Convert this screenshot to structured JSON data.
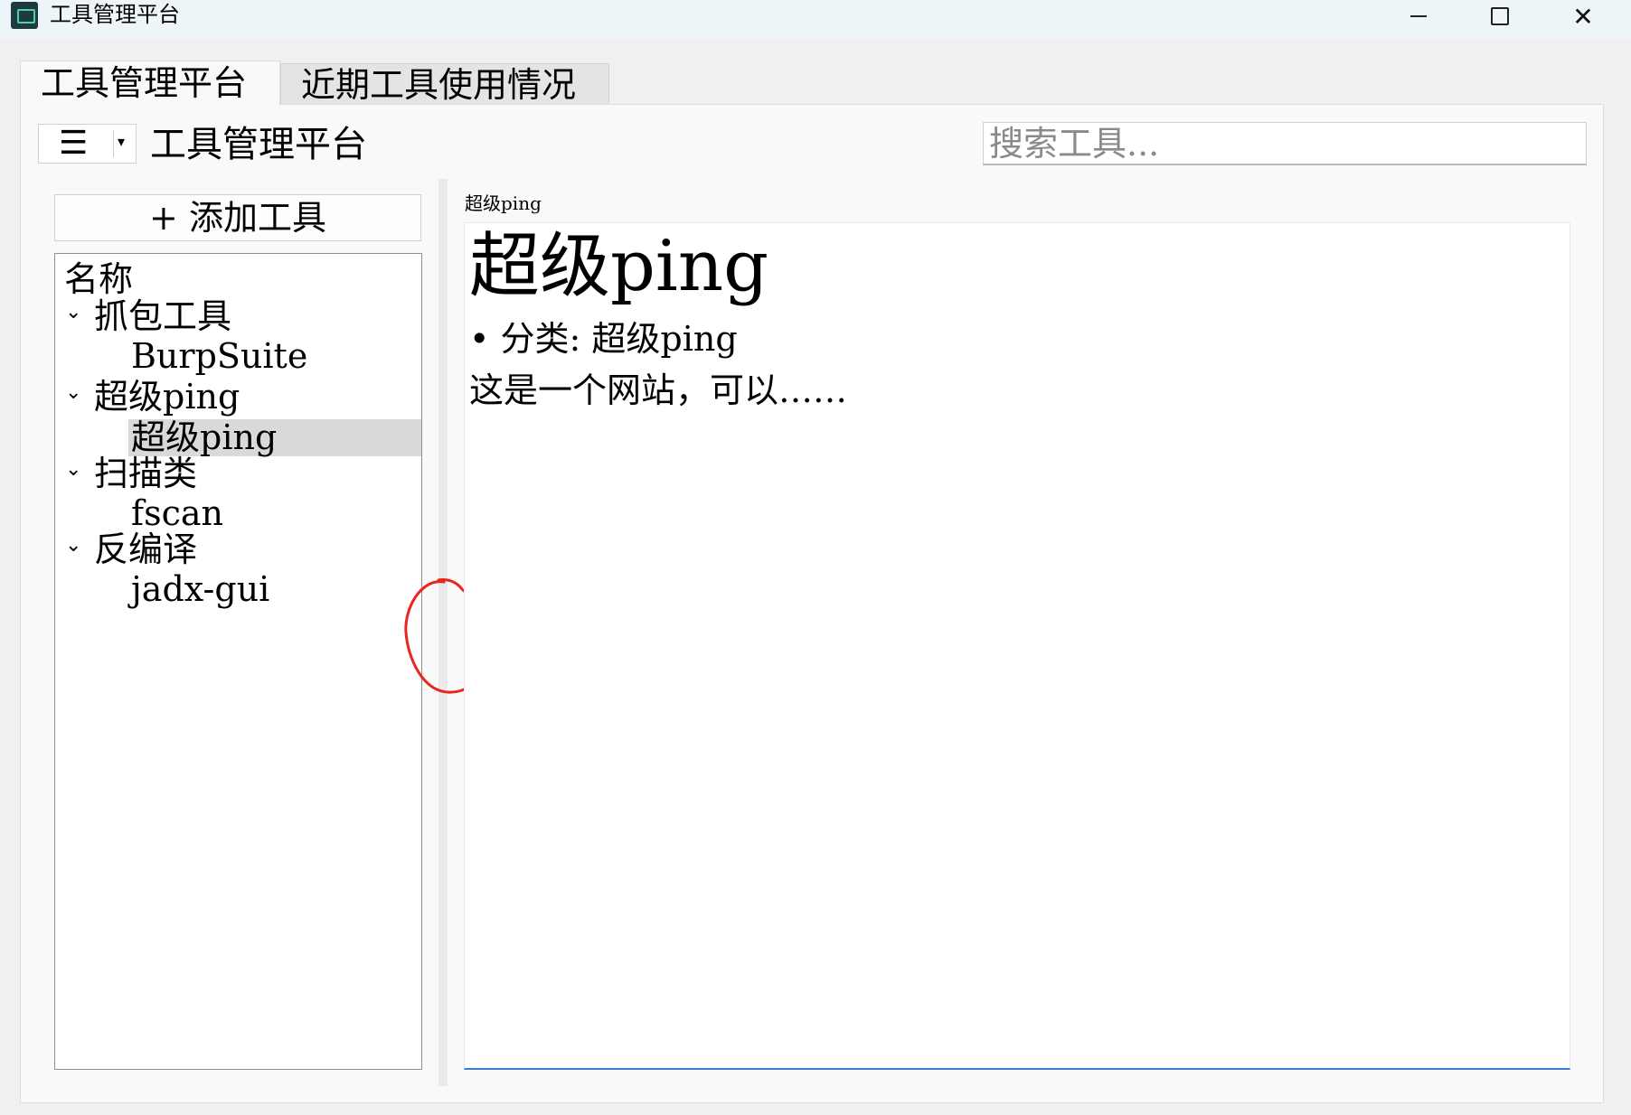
{
  "window": {
    "title": "工具管理平台",
    "minimize_icon": "minimize-icon",
    "maximize_icon": "maximize-icon",
    "close_glyph": "✕"
  },
  "tabs": [
    {
      "label": "工具管理平台",
      "active": true
    },
    {
      "label": "近期工具使用情况",
      "active": false
    }
  ],
  "toolbar": {
    "menu_glyph": "☰",
    "menu_arrow": "▾",
    "title": "工具管理平台",
    "search_placeholder": "搜索工具..."
  },
  "sidebar": {
    "add_button_label": "+ 添加工具",
    "tree_header": "名称",
    "categories": [
      {
        "label": "抓包工具",
        "expanded": true,
        "items": [
          "BurpSuite"
        ]
      },
      {
        "label": "超级ping",
        "expanded": true,
        "items": [
          "超级ping"
        ]
      },
      {
        "label": "扫描类",
        "expanded": true,
        "items": [
          "fscan"
        ]
      },
      {
        "label": "反编译",
        "expanded": true,
        "items": [
          "jadx-gui"
        ]
      }
    ],
    "selected_item": "超级ping",
    "chevron_glyph": "⌄"
  },
  "detail": {
    "label": "超级ping",
    "title": "超级ping",
    "bullet": "• 分类: 超级ping",
    "description": "这是一个网站，可以……"
  },
  "annotation": {
    "color": "#e8261c"
  },
  "colors": {
    "selection": "#d9d9d9",
    "focus_underline": "#3b7bd6"
  }
}
